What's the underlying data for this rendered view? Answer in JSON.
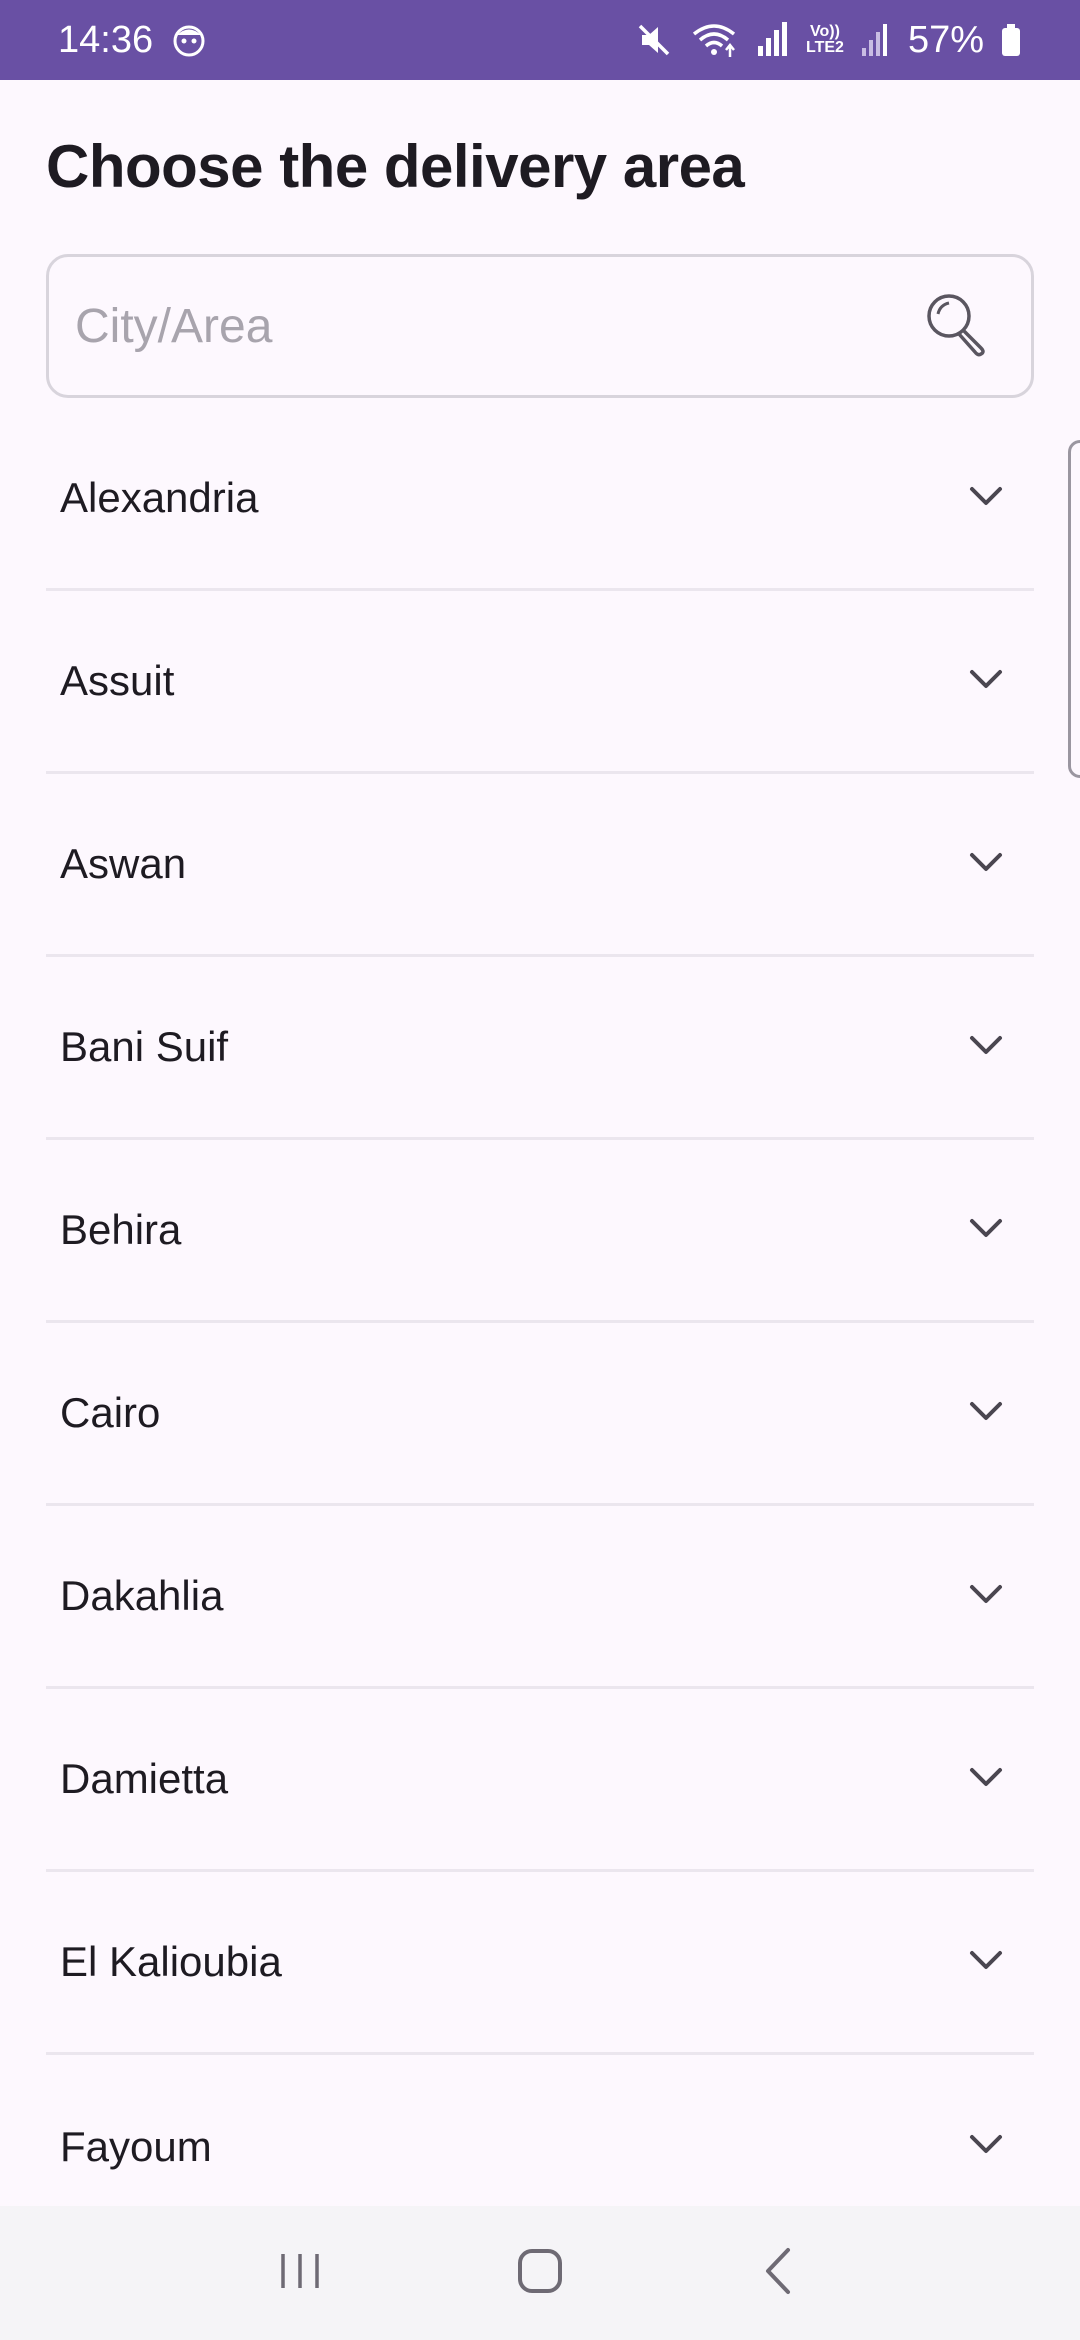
{
  "status_bar": {
    "time": "14:36",
    "battery": "57%",
    "network_label": "LTE2"
  },
  "page": {
    "title": "Choose the delivery area"
  },
  "search": {
    "placeholder": "City/Area",
    "value": ""
  },
  "cities": [
    {
      "label": "Alexandria"
    },
    {
      "label": "Assuit"
    },
    {
      "label": "Aswan"
    },
    {
      "label": "Bani Suif"
    },
    {
      "label": "Behira"
    },
    {
      "label": "Cairo"
    },
    {
      "label": "Dakahlia"
    },
    {
      "label": "Damietta"
    },
    {
      "label": "El Kalioubia"
    },
    {
      "label": "Fayoum"
    }
  ],
  "colors": {
    "status_bar": "#6950a4",
    "background": "#fdf8fe",
    "text": "#1e1b22",
    "placeholder": "#a8a4ad",
    "divider": "#ebe6ee",
    "chevron": "#4a4650"
  },
  "icons": {
    "search": "search-icon",
    "expand": "chevron-down-icon",
    "recents": "recents-icon",
    "home": "home-icon",
    "back": "back-icon"
  }
}
